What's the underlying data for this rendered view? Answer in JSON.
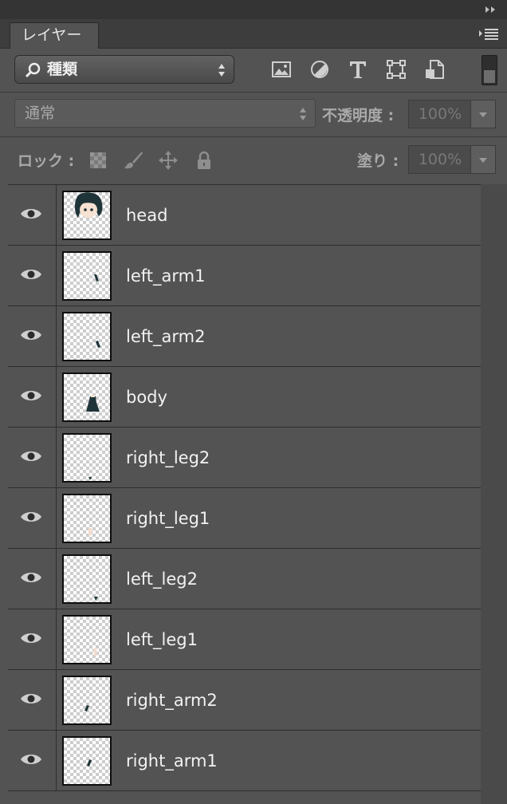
{
  "panel": {
    "tab_label": "レイヤー"
  },
  "filter": {
    "selected": "種類"
  },
  "blend": {
    "mode": "通常",
    "opacity_label": "不透明度 :",
    "opacity_value": "100%"
  },
  "lock": {
    "label": "ロック :",
    "fill_label": "塗り :",
    "fill_value": "100%"
  },
  "layers": [
    {
      "name": "head",
      "thumb": "head",
      "visible": true
    },
    {
      "name": "left_arm1",
      "thumb": "left_arm1",
      "visible": true
    },
    {
      "name": "left_arm2",
      "thumb": "left_arm2",
      "visible": true
    },
    {
      "name": "body",
      "thumb": "body",
      "visible": true
    },
    {
      "name": "right_leg2",
      "thumb": "right_leg2",
      "visible": true
    },
    {
      "name": "right_leg1",
      "thumb": "right_leg1",
      "visible": true
    },
    {
      "name": "left_leg2",
      "thumb": "left_leg2",
      "visible": true
    },
    {
      "name": "left_leg1",
      "thumb": "left_leg1",
      "visible": true
    },
    {
      "name": "right_arm2",
      "thumb": "right_arm2",
      "visible": true
    },
    {
      "name": "right_arm1",
      "thumb": "right_arm1",
      "visible": true
    }
  ]
}
